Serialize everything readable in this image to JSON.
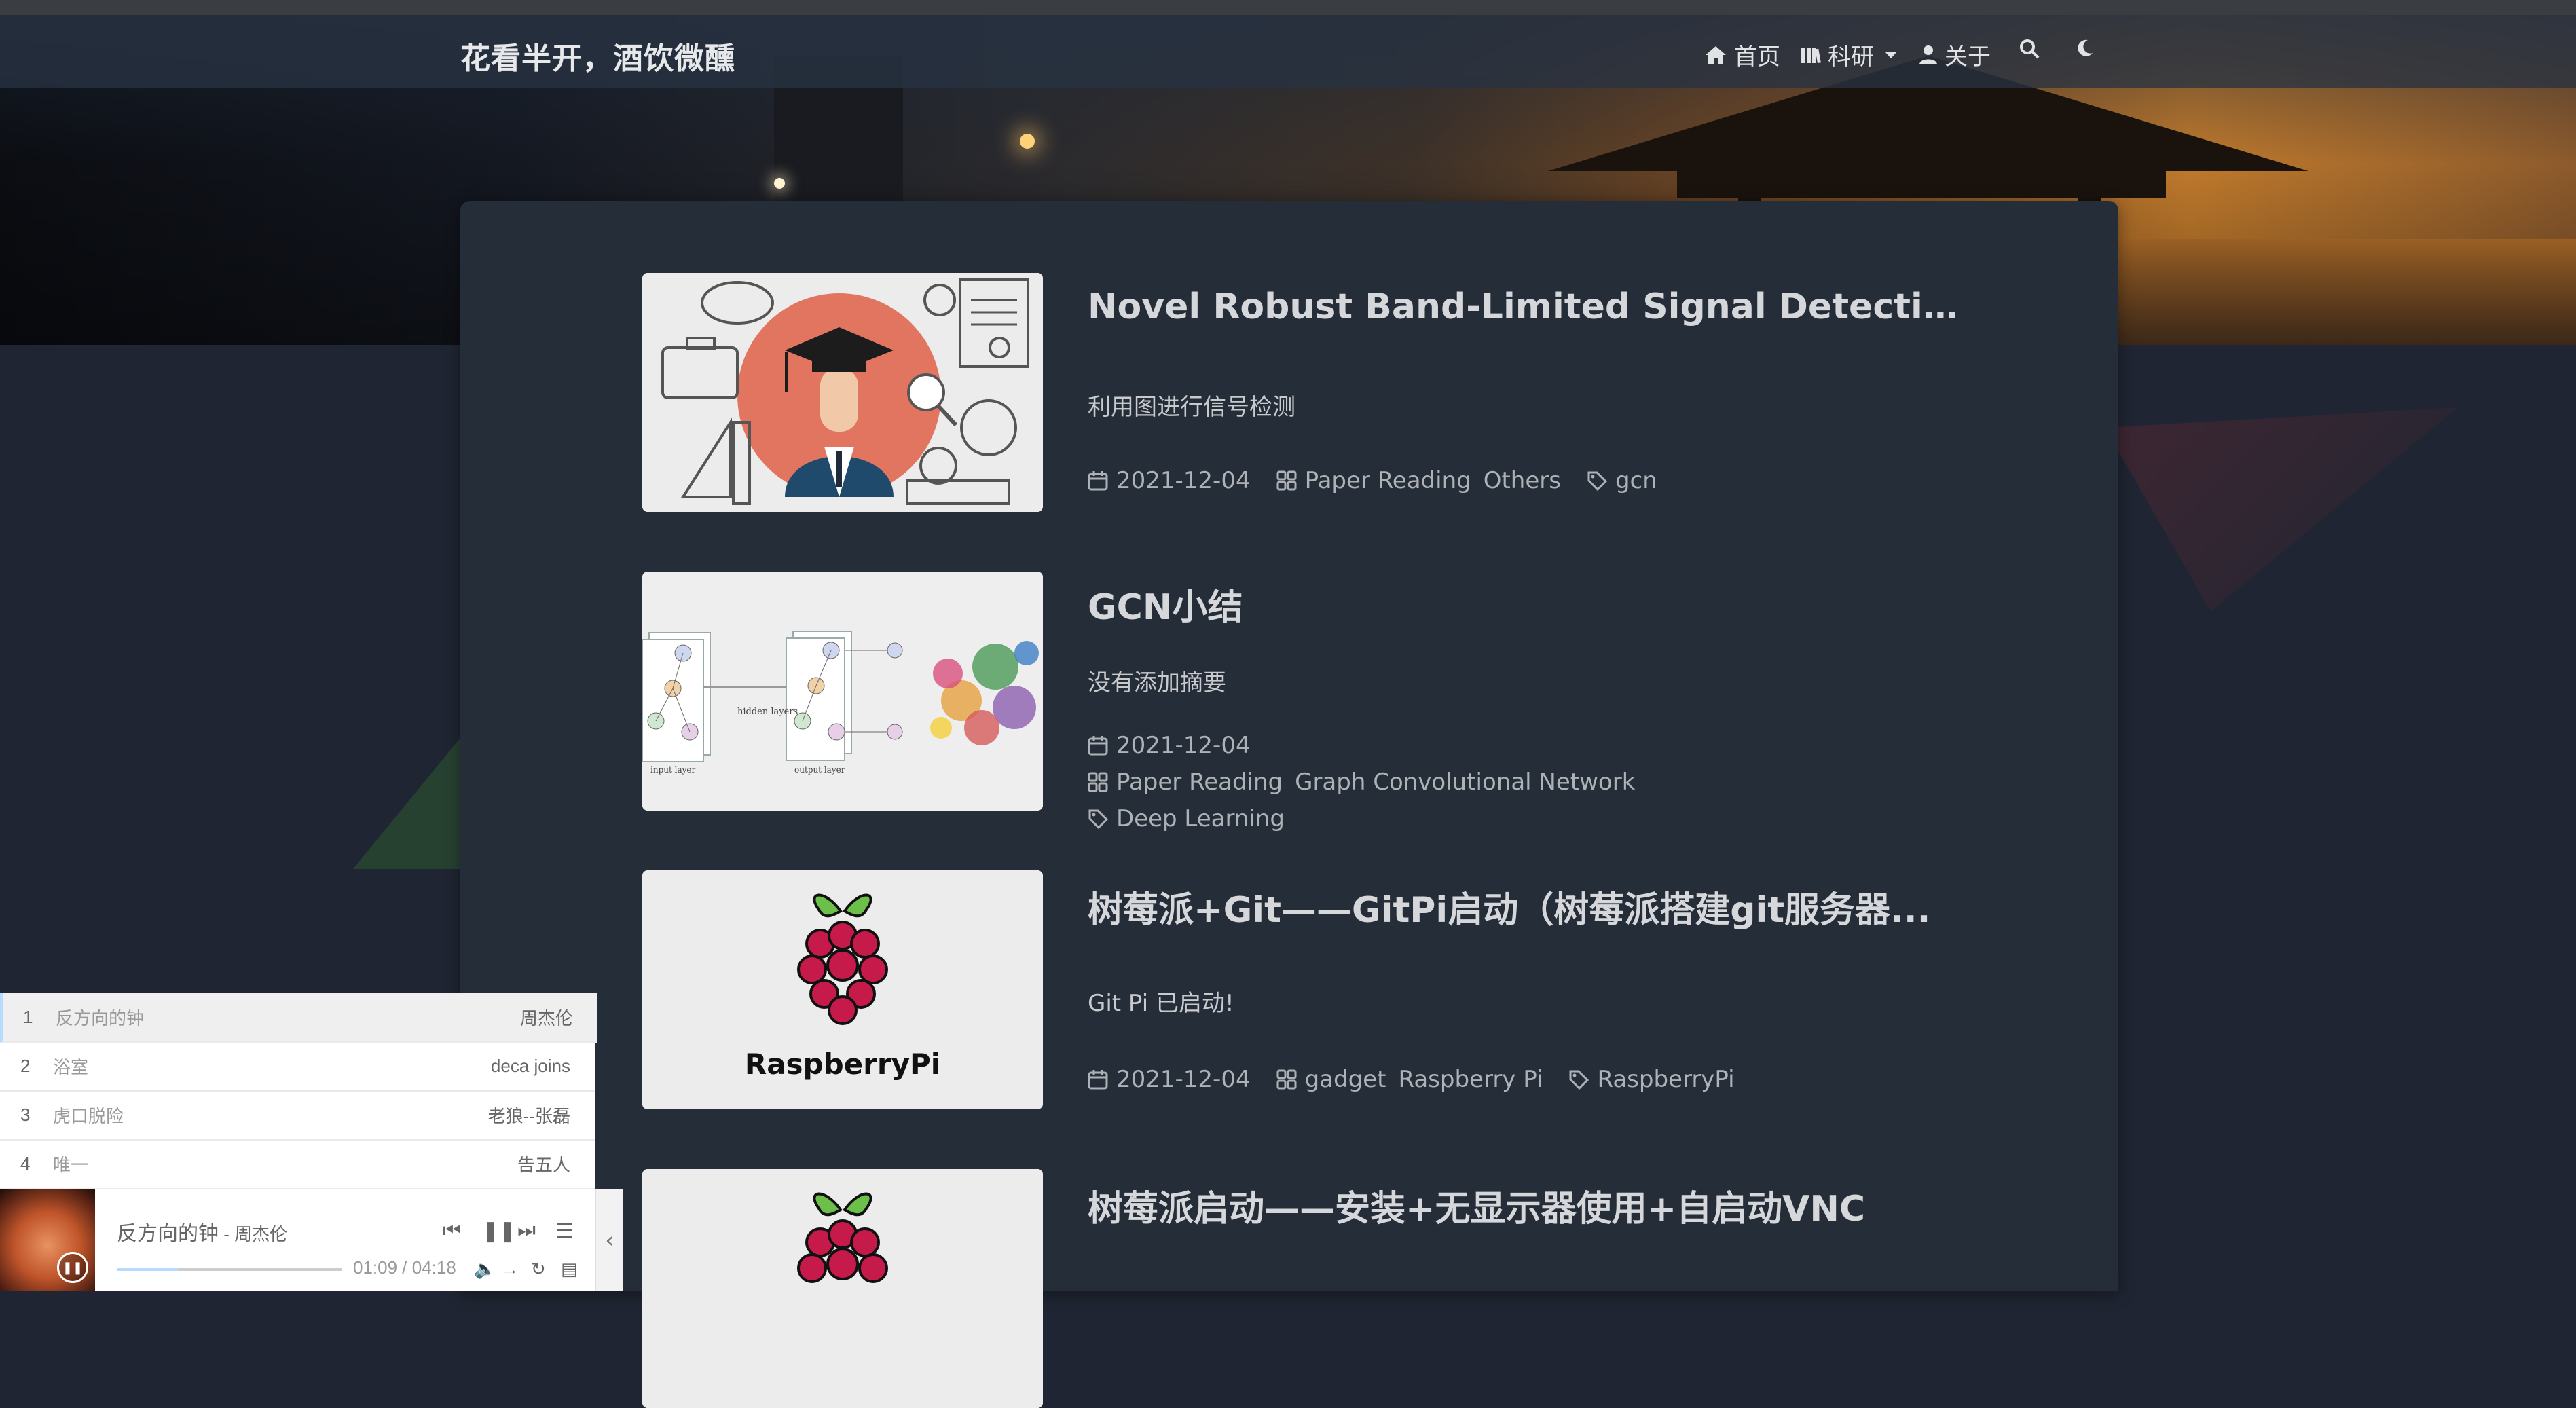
{
  "site": {
    "brand": "花看半开，酒饮微醺"
  },
  "nav": {
    "home": {
      "icon": "home-icon",
      "label": "首页"
    },
    "research": {
      "icon": "books-icon",
      "label": "科研"
    },
    "about": {
      "icon": "user-icon",
      "label": "关于"
    },
    "search": {
      "icon": "search-icon"
    },
    "theme": {
      "icon": "moon-icon"
    }
  },
  "posts": [
    {
      "title": "Novel Robust Band-Limited Signal Detection A...",
      "summary": "利用图进行信号检测",
      "date": "2021-12-04",
      "categories": [
        "Paper Reading",
        "Others"
      ],
      "tags": [
        "gcn"
      ]
    },
    {
      "title": "GCN小结",
      "summary": "没有添加摘要",
      "date": "2021-12-04",
      "categories": [
        "Paper Reading",
        "Graph Convolutional Network"
      ],
      "tags": [
        "Deep Learning"
      ]
    },
    {
      "title": "树莓派+Git——GitPi启动（树莓派搭建git服务器...",
      "summary": "Git Pi 已启动!",
      "date": "2021-12-04",
      "categories": [
        "gadget",
        "Raspberry Pi"
      ],
      "tags": [
        "RaspberryPi"
      ]
    },
    {
      "title": "树莓派启动——安装+无显示器使用+自启动VNC",
      "summary": "",
      "date": "",
      "categories": [],
      "tags": []
    }
  ],
  "thumbs": {
    "raspberry_text": "RaspberryPi",
    "gcn_labels": {
      "hidden": "hidden layers",
      "input": "input layer",
      "output": "output layer"
    }
  },
  "player": {
    "playlist": [
      {
        "index": "1",
        "name": "反方向的钟",
        "artist": "周杰伦"
      },
      {
        "index": "2",
        "name": "浴室",
        "artist": "deca joins"
      },
      {
        "index": "3",
        "name": "虎口脱险",
        "artist": "老狼--张磊"
      },
      {
        "index": "4",
        "name": "唯一",
        "artist": "告五人"
      }
    ],
    "now_playing": {
      "title": "反方向的钟",
      "artist_sep": " - 周杰伦"
    },
    "time": "01:09 / 04:18",
    "progress": 0.27
  },
  "colors": {
    "card_bg": "#252d38",
    "page_bg": "#1f2532",
    "player_accent": "#b7daff"
  }
}
